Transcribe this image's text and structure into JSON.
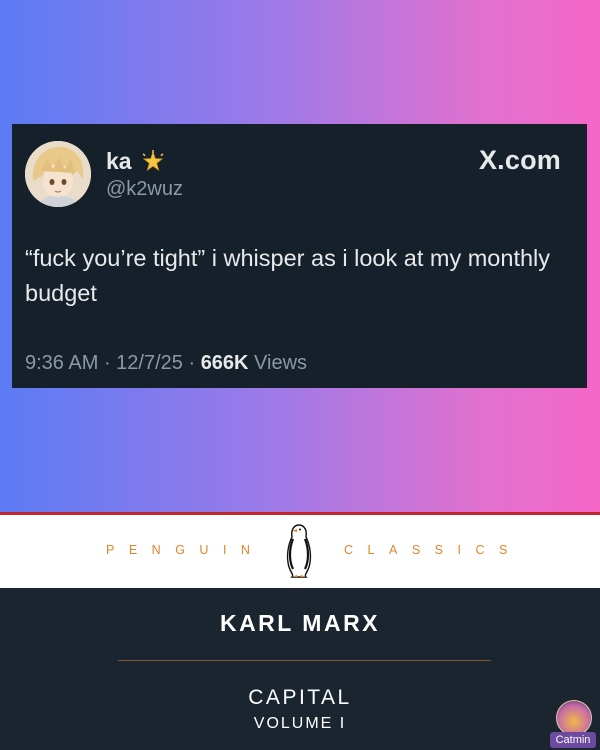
{
  "tweet": {
    "display_name": "ka",
    "handle": "@k2wuz",
    "brand": "X.com",
    "text": "“fuck you’re tight” i whisper as i look at my monthly budget",
    "time": "9:36 AM",
    "sep1": " · ",
    "date": "12/7/25",
    "sep2": " · ",
    "views_count": "666K",
    "views_label": " Views",
    "badge_icon": "sparkle-star-icon",
    "colors": {
      "card_bg": "#15202b",
      "text": "#e7e9ea",
      "muted": "#8b98a5"
    }
  },
  "book": {
    "publisher_left": "PENGUIN",
    "publisher_right": "CLASSICS",
    "author": "KARL MARX",
    "title": "CAPITAL",
    "subtitle": "VOLUME I",
    "colors": {
      "accent": "#e0852a",
      "dark": "#1a2530",
      "rule": "#c2262e"
    }
  },
  "watermark": {
    "label": "Catmin"
  },
  "background": {
    "gradient_start": "#5b7bf4",
    "gradient_end": "#f567c8"
  }
}
